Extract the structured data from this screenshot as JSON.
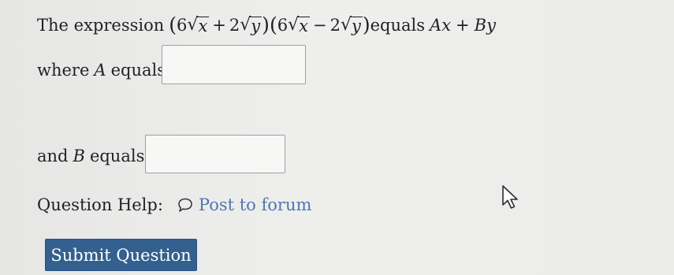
{
  "question": {
    "prefix": "The expression",
    "factor1": {
      "coef1": "6",
      "rad1": "x",
      "op": "+",
      "coef2": "2",
      "rad2": "y"
    },
    "factor2": {
      "coef1": "6",
      "rad1": "x",
      "op": "−",
      "coef2": "2",
      "rad2": "y"
    },
    "equals_word": "equals",
    "result": {
      "term1_coef": "A",
      "term1_var": "x",
      "op": "+",
      "term2_coef": "B",
      "term2_var": "y"
    }
  },
  "field_a": {
    "label_pre": "where",
    "label_var": "A",
    "label_post": "equals:",
    "value": ""
  },
  "field_b": {
    "label_pre": "and",
    "label_var": "B",
    "label_post": "equals:",
    "value": ""
  },
  "help": {
    "label": "Question Help:",
    "forum_icon": "speech-bubble-icon",
    "forum_link": "Post to forum"
  },
  "submit": {
    "label": "Submit Question"
  },
  "colors": {
    "link": "#4f77b3",
    "button": "#33608f",
    "text": "#1f2126"
  }
}
